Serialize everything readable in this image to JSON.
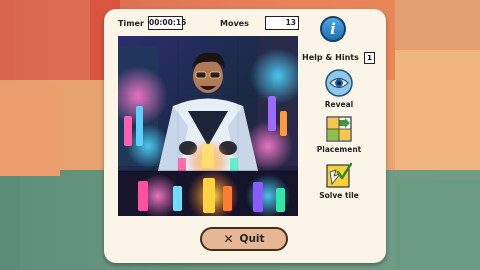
{
  "header": {
    "timer_label": "Timer",
    "timer_value": "00:00:15",
    "moves_label": "Moves",
    "moves_value": "13"
  },
  "info_button": {
    "label": "i",
    "icon": "info-icon"
  },
  "hints": {
    "title": "Help & Hints",
    "count": "1",
    "items": [
      {
        "label": "Reveal",
        "icon": "eye-icon"
      },
      {
        "label": "Placement",
        "icon": "placement-icon"
      },
      {
        "label": "Solve tile",
        "icon": "solve-tile-icon"
      }
    ]
  },
  "quit": {
    "label": "Quit",
    "icon": "close-icon"
  },
  "puzzle": {
    "image_subject": "scientist-in-neon-lab",
    "grid": "3x3"
  }
}
